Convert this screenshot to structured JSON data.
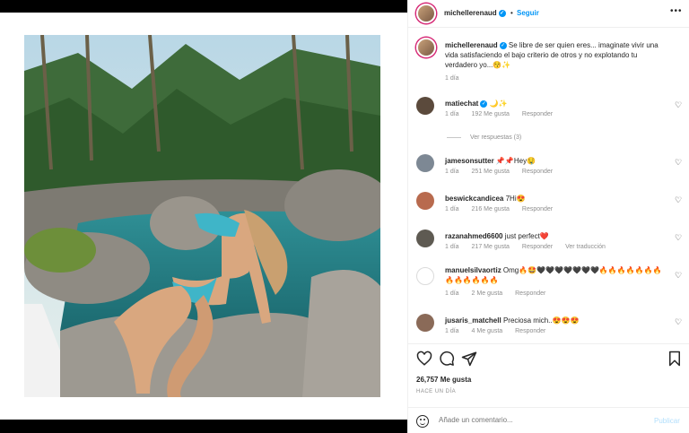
{
  "post": {
    "username": "michellerenaud",
    "follow_label": "Seguir",
    "dot": "•",
    "more": "•••"
  },
  "caption": {
    "username": "michellerenaud",
    "text": "Se libre de ser quien eres... imaginate vivir una vida satisfaciendo el bajo criterio de otros y no explotando tu verdadero yo...😚✨",
    "time": "1 día"
  },
  "comments": [
    {
      "username": "matiechat",
      "badge": "✓",
      "text": " 🌙✨",
      "time": "1 día",
      "likes": "192 Me gusta",
      "reply": "Responder",
      "translate": ""
    },
    {
      "username": "jamesonsutter",
      "text": "📌📌Hey🤤",
      "time": "1 día",
      "likes": "251 Me gusta",
      "reply": "Responder",
      "translate": ""
    },
    {
      "username": "beswickcandicea",
      "text": "7Hi😍",
      "time": "1 día",
      "likes": "216 Me gusta",
      "reply": "Responder",
      "translate": ""
    },
    {
      "username": "razanahmed6600",
      "text": "just perfect❤️",
      "time": "1 día",
      "likes": "217 Me gusta",
      "reply": "Responder",
      "translate": "Ver traducción"
    },
    {
      "username": "manuelsilvaortiz",
      "text": "Omg🔥🤩🖤🖤🖤🖤🖤🖤🖤🔥🔥🔥🔥🔥🔥🔥🔥🔥🔥🔥🔥🔥",
      "time": "1 día",
      "likes": "2 Me gusta",
      "reply": "Responder",
      "translate": ""
    },
    {
      "username": "jusaris_matchell",
      "text": "Preciosa mich..😍😍😍",
      "time": "1 día",
      "likes": "4 Me gusta",
      "reply": "Responder",
      "translate": ""
    }
  ],
  "view_replies": "Ver respuestas (3)",
  "likes_count": "26,757 Me gusta",
  "posted_ago": "HACE UN DÍA",
  "add_comment": {
    "placeholder": "Añade un comentario...",
    "publish": "Publicar"
  },
  "colors": {
    "link": "#0095f6",
    "muted": "#8e8e8e",
    "publish_disabled": "#b2dffc"
  }
}
